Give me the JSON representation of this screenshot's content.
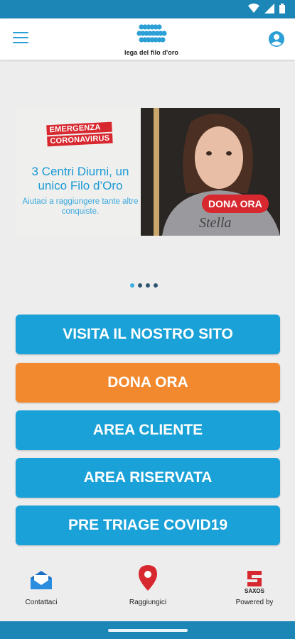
{
  "status_bar": {
    "icons": [
      "wifi-icon",
      "signal-icon",
      "battery-icon"
    ]
  },
  "app_bar": {
    "logo_text": "lega del filo d'oro",
    "menu_icon": "hamburger-icon",
    "account_icon": "account-icon"
  },
  "banner": {
    "emergency_line1": "EMERGENZA",
    "emergency_line2": "CORONAVIRUS",
    "title": "3 Centri Diurni, un unico Filo d’Oro",
    "subtitle": "Aiutaci a raggiungere tante altre conquiste.",
    "badge": "DONA ORA",
    "shirt_text": "Stella"
  },
  "carousel": {
    "count": 4,
    "active_index": 0
  },
  "buttons": {
    "visit_site": "VISITA IL NOSTRO SITO",
    "donate": "DONA ORA",
    "client_area": "AREA CLIENTE",
    "reserved_area": "AREA RISERVATA",
    "pre_triage": "PRE TRIAGE COVID19"
  },
  "bottom_nav": {
    "contacts": "Contattaci",
    "reach_us": "Raggiungici",
    "powered_by": "Powered by",
    "powered_brand": "SAXOS"
  },
  "colors": {
    "primary": "#1aa2d8",
    "accent": "#f2892e",
    "status": "#1c86b7",
    "red": "#d8282f"
  }
}
